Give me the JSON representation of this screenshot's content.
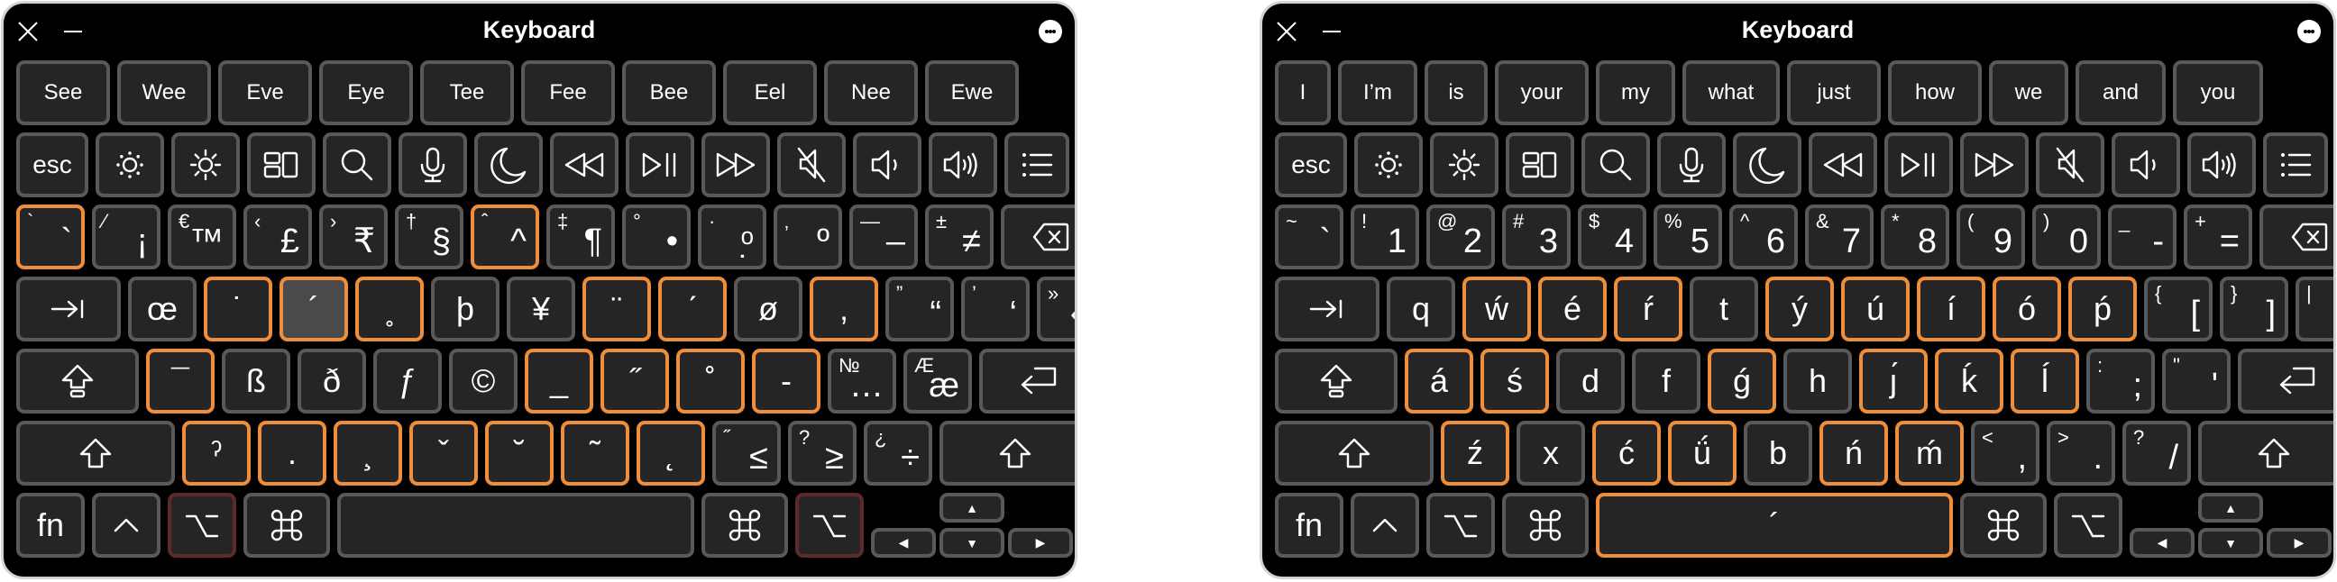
{
  "windows": [
    {
      "id": "left",
      "title": "Keyboard",
      "state": "option-pressed",
      "suggestions": [
        "See",
        "Wee",
        "Eve",
        "Eye",
        "Tee",
        "Fee",
        "Bee",
        "Eel",
        "Nee",
        "Ewe"
      ],
      "function_row": [
        {
          "label": "esc"
        },
        {
          "icon": "brightness-down-icon"
        },
        {
          "icon": "brightness-up-icon"
        },
        {
          "icon": "mission-control-icon"
        },
        {
          "icon": "search-icon"
        },
        {
          "icon": "microphone-icon"
        },
        {
          "icon": "do-not-disturb-moon-icon"
        },
        {
          "icon": "rewind-icon"
        },
        {
          "icon": "play-pause-icon"
        },
        {
          "icon": "fast-forward-icon"
        },
        {
          "icon": "mute-icon"
        },
        {
          "icon": "volume-down-icon"
        },
        {
          "icon": "volume-up-icon"
        },
        {
          "icon": "list-icon"
        }
      ],
      "number_row": [
        {
          "alt": "`",
          "main": "`",
          "dead": true
        },
        {
          "alt": "⁄",
          "main": "¡"
        },
        {
          "alt": "€",
          "main": "™"
        },
        {
          "alt": "‹",
          "main": "£"
        },
        {
          "alt": "›",
          "main": "₹"
        },
        {
          "alt": "†",
          "main": "§"
        },
        {
          "alt": "ˆ",
          "main": "^",
          "dead": true
        },
        {
          "alt": "‡",
          "main": "¶"
        },
        {
          "alt": "°",
          "main": "•"
        },
        {
          "alt": "·",
          "main": "ᵒ̣"
        },
        {
          "alt": "‚",
          "main": "º"
        },
        {
          "alt": "—",
          "main": "–"
        },
        {
          "alt": "±",
          "main": "≠"
        },
        {
          "icon": "delete-icon",
          "label": "delete"
        }
      ],
      "tab_row": [
        {
          "icon": "tab-icon",
          "label": "tab"
        },
        {
          "main": "œ"
        },
        {
          "main": "˙",
          "dead": true
        },
        {
          "main": "´",
          "dead": true,
          "pressed": true
        },
        {
          "main": "˳",
          "dead": true
        },
        {
          "main": "þ"
        },
        {
          "main": "¥"
        },
        {
          "main": "¨",
          "dead": true
        },
        {
          "main": "ˊ",
          "dead": true
        },
        {
          "main": "ø"
        },
        {
          "main": "‚",
          "dead": true
        },
        {
          "alt": "”",
          "main": "“"
        },
        {
          "alt": "’",
          "main": "‘"
        },
        {
          "alt": "»",
          "main": "«"
        }
      ],
      "caps_row": [
        {
          "icon": "caps-lock-icon",
          "label": "caps lock"
        },
        {
          "main": "¯",
          "dead": true
        },
        {
          "main": "ß"
        },
        {
          "main": "ð"
        },
        {
          "main": "ƒ"
        },
        {
          "main": "©"
        },
        {
          "main": "_",
          "dead": true
        },
        {
          "main": "˝",
          "dead": true
        },
        {
          "main": "˚",
          "dead": true
        },
        {
          "main": "-",
          "dead": true
        },
        {
          "alt": "№",
          "main": "…"
        },
        {
          "alt": "Æ",
          "main": "æ"
        },
        {
          "icon": "return-icon",
          "label": "return"
        }
      ],
      "shift_row": [
        {
          "icon": "shift-icon",
          "label": "shift"
        },
        {
          "main": "ˀ",
          "dead": true
        },
        {
          "main": ".",
          "dead": true
        },
        {
          "main": "¸",
          "dead": true
        },
        {
          "main": "ˇ",
          "dead": true
        },
        {
          "main": "˘",
          "dead": true
        },
        {
          "main": "˜",
          "dead": true
        },
        {
          "main": "˛",
          "dead": true
        },
        {
          "alt": "˝",
          "main": "≤"
        },
        {
          "alt": "?",
          "main": "≥"
        },
        {
          "alt": "¿",
          "main": "÷"
        },
        {
          "icon": "shift-icon",
          "label": "shift"
        }
      ],
      "bottom_row": [
        {
          "label": "fn"
        },
        {
          "icon": "control-icon",
          "label": "control"
        },
        {
          "icon": "option-icon",
          "label": "option",
          "active": true
        },
        {
          "icon": "command-icon",
          "label": "command"
        },
        {
          "space": true,
          "main": ""
        },
        {
          "icon": "command-icon",
          "label": "command"
        },
        {
          "icon": "option-icon",
          "label": "option",
          "active": true
        }
      ],
      "arrows": {
        "up": "▲",
        "left": "◀",
        "down": "▼",
        "right": "▶"
      }
    },
    {
      "id": "right",
      "title": "Keyboard",
      "state": "acute-dead-key",
      "suggestions": [
        "I",
        "I’m",
        "is",
        "your",
        "my",
        "what",
        "just",
        "how",
        "we",
        "and",
        "you"
      ],
      "function_row": [
        {
          "label": "esc"
        },
        {
          "icon": "brightness-down-icon"
        },
        {
          "icon": "brightness-up-icon"
        },
        {
          "icon": "mission-control-icon"
        },
        {
          "icon": "search-icon"
        },
        {
          "icon": "microphone-icon"
        },
        {
          "icon": "do-not-disturb-moon-icon"
        },
        {
          "icon": "rewind-icon"
        },
        {
          "icon": "play-pause-icon"
        },
        {
          "icon": "fast-forward-icon"
        },
        {
          "icon": "mute-icon"
        },
        {
          "icon": "volume-down-icon"
        },
        {
          "icon": "volume-up-icon"
        },
        {
          "icon": "list-icon"
        }
      ],
      "number_row": [
        {
          "alt": "~",
          "main": "`"
        },
        {
          "alt": "!",
          "main": "1"
        },
        {
          "alt": "@",
          "main": "2"
        },
        {
          "alt": "#",
          "main": "3"
        },
        {
          "alt": "$",
          "main": "4"
        },
        {
          "alt": "%",
          "main": "5"
        },
        {
          "alt": "^",
          "main": "6"
        },
        {
          "alt": "&",
          "main": "7"
        },
        {
          "alt": "*",
          "main": "8"
        },
        {
          "alt": "(",
          "main": "9"
        },
        {
          "alt": ")",
          "main": "0"
        },
        {
          "alt": "_",
          "main": "-"
        },
        {
          "alt": "+",
          "main": "="
        },
        {
          "icon": "delete-icon",
          "label": "delete"
        }
      ],
      "tab_row": [
        {
          "icon": "tab-icon",
          "label": "tab"
        },
        {
          "main": "q"
        },
        {
          "main": "ẃ",
          "dead": true
        },
        {
          "main": "é",
          "dead": true
        },
        {
          "main": "ŕ",
          "dead": true
        },
        {
          "main": "t"
        },
        {
          "main": "ý",
          "dead": true
        },
        {
          "main": "ú",
          "dead": true
        },
        {
          "main": "í",
          "dead": true
        },
        {
          "main": "ó",
          "dead": true
        },
        {
          "main": "ṕ",
          "dead": true
        },
        {
          "alt": "{",
          "main": "["
        },
        {
          "alt": "}",
          "main": "]"
        },
        {
          "alt": "|",
          "main": "\\"
        }
      ],
      "caps_row": [
        {
          "icon": "caps-lock-icon",
          "label": "caps lock"
        },
        {
          "main": "á",
          "dead": true
        },
        {
          "main": "ś",
          "dead": true
        },
        {
          "main": "d"
        },
        {
          "main": "f"
        },
        {
          "main": "ǵ",
          "dead": true
        },
        {
          "main": "h"
        },
        {
          "main": "ȷ́",
          "dead": true
        },
        {
          "main": "ḱ",
          "dead": true
        },
        {
          "main": "ĺ",
          "dead": true
        },
        {
          "alt": ":",
          "main": ";"
        },
        {
          "alt": "\"",
          "main": "'"
        },
        {
          "icon": "return-icon",
          "label": "return"
        }
      ],
      "shift_row": [
        {
          "icon": "shift-icon",
          "label": "shift"
        },
        {
          "main": "ź",
          "dead": true
        },
        {
          "main": "x"
        },
        {
          "main": "ć",
          "dead": true
        },
        {
          "main": "ǘ",
          "dead": true
        },
        {
          "main": "b"
        },
        {
          "main": "ń",
          "dead": true
        },
        {
          "main": "ḿ",
          "dead": true
        },
        {
          "alt": "<",
          "main": ","
        },
        {
          "alt": ">",
          "main": "."
        },
        {
          "alt": "?",
          "main": "/"
        },
        {
          "icon": "shift-icon",
          "label": "shift"
        }
      ],
      "bottom_row": [
        {
          "label": "fn"
        },
        {
          "icon": "control-icon",
          "label": "control"
        },
        {
          "icon": "option-icon",
          "label": "option"
        },
        {
          "icon": "command-icon",
          "label": "command"
        },
        {
          "space": true,
          "main": "´",
          "dead": true
        },
        {
          "icon": "command-icon",
          "label": "command"
        },
        {
          "icon": "option-icon",
          "label": "option"
        }
      ],
      "arrows": {
        "up": "▲",
        "left": "◀",
        "down": "▼",
        "right": "▶"
      }
    }
  ],
  "colors": {
    "window_bg": "#000000",
    "key_bg": "#252525",
    "key_border": "#595959",
    "dead_key_border": "#ee8d3a",
    "pressed_key_bg": "#4a4a4a",
    "active_modifier_border": "#5c2a27",
    "text": "#ffffff"
  }
}
